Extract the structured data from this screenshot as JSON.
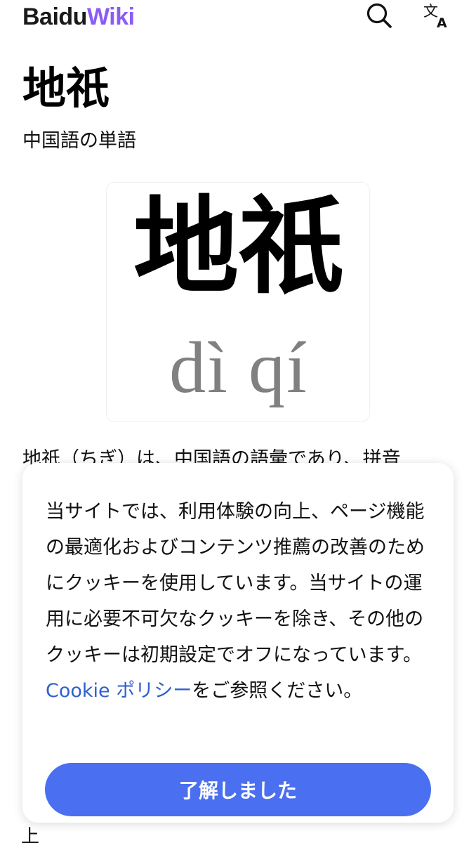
{
  "header": {
    "logo_part1": "Baidu",
    "logo_part2": "Wiki",
    "icons": [
      "search-icon",
      "translate-icon"
    ]
  },
  "article": {
    "title": "地祇",
    "subtitle": "中国語の単語",
    "image": {
      "hanzi": "地祇",
      "pinyin": "dì qí"
    },
    "first_line": "地祇（ちぎ）は、中国語の語彙であり、拼音",
    "bottom_glyph": "上"
  },
  "cookie_banner": {
    "text": "当サイトでは、利用体験の向上、ページ機能の最適化およびコンテンツ推薦の改善のためにクッキーを使用しています。当サイトの運用に必要不可欠なクッキーを除き、その他のクッキーは初期設定でオフになっています。",
    "link_text": "Cookie ポリシー",
    "text_after": "をご参照ください。",
    "accept_label": "了解しました"
  },
  "colors": {
    "logo_accent": "#8b5cf6",
    "link": "#2f5fcf",
    "button": "#4a6ff0"
  }
}
